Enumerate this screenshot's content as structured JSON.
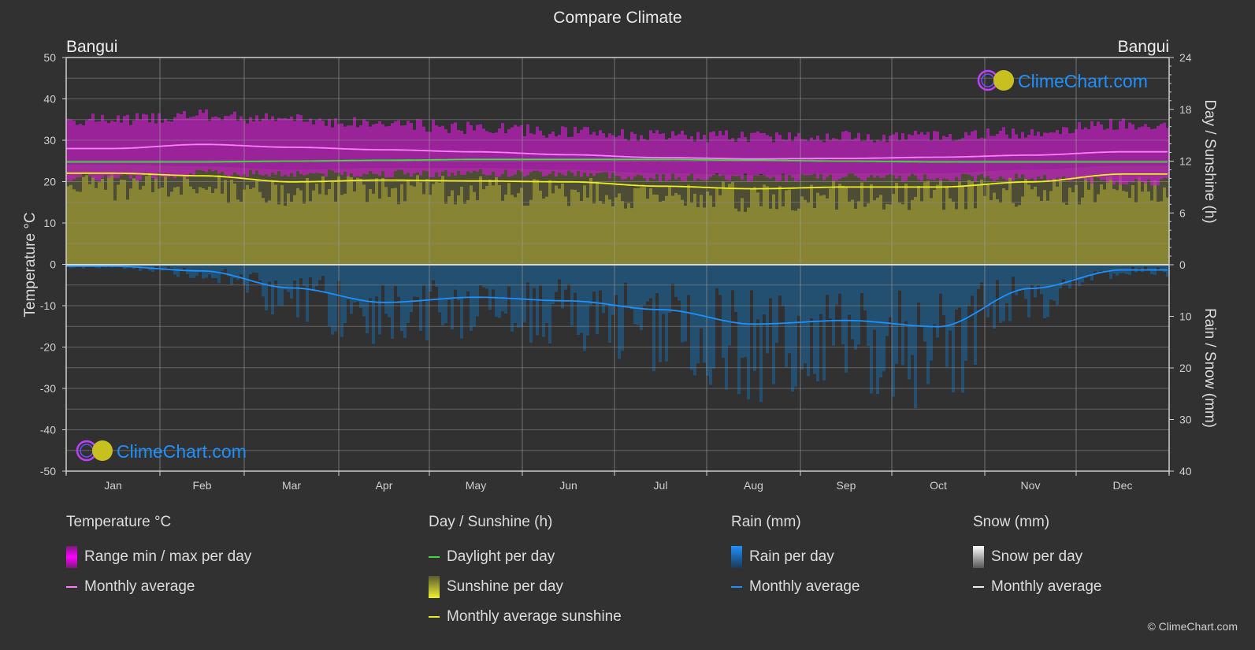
{
  "title": "Compare Climate",
  "location_left": "Bangui",
  "location_right": "Bangui",
  "watermark": "ClimeChart.com",
  "copyright": "© ClimeChart.com",
  "colors": {
    "background": "#313131",
    "temp_range": "#c81ec8",
    "temp_avg": "#ff7cff",
    "daylight": "#3ddc3d",
    "sunshine_fill": "#8c8a35",
    "sunshine_avg": "#f0f020",
    "rain_fill": "#1f5a85",
    "rain_avg": "#1e90ff",
    "brand": "#1e90ff"
  },
  "legend": {
    "temperature": {
      "title": "Temperature °C",
      "items": [
        "Range min / max per day",
        "Monthly average"
      ]
    },
    "sunshine": {
      "title": "Day / Sunshine (h)",
      "items": [
        "Daylight per day",
        "Sunshine per day",
        "Monthly average sunshine"
      ]
    },
    "rain": {
      "title": "Rain (mm)",
      "items": [
        "Rain per day",
        "Monthly average"
      ]
    },
    "snow": {
      "title": "Snow (mm)",
      "items": [
        "Snow per day",
        "Monthly average"
      ]
    }
  },
  "chart_data": {
    "type": "area",
    "title": "Compare Climate",
    "categories": [
      "Jan",
      "Feb",
      "Mar",
      "Apr",
      "May",
      "Jun",
      "Jul",
      "Aug",
      "Sep",
      "Oct",
      "Nov",
      "Dec"
    ],
    "y_left": {
      "label": "Temperature °C",
      "range": [
        -50,
        50
      ],
      "ticks": [
        "50",
        "40",
        "30",
        "20",
        "10",
        "0",
        "-10",
        "-20",
        "-30",
        "-40",
        "-50"
      ]
    },
    "y_right_top": {
      "label": "Day / Sunshine (h)",
      "range": [
        0,
        24
      ],
      "ticks": [
        "24",
        "18",
        "12",
        "6",
        "0"
      ]
    },
    "y_right_bottom": {
      "label": "Rain / Snow (mm)",
      "range": [
        0,
        40
      ],
      "ticks": [
        "0",
        "10",
        "20",
        "30",
        "40"
      ]
    },
    "grid": true,
    "series": [
      {
        "name": "Temperature max (approx daily band top)",
        "axis": "temp",
        "values": [
          35,
          36,
          35,
          34,
          33,
          32,
          31,
          31,
          31,
          31,
          32,
          34
        ]
      },
      {
        "name": "Temperature min (approx daily band bottom)",
        "axis": "temp",
        "values": [
          21,
          22,
          22,
          22,
          22,
          22,
          21,
          21,
          21,
          21,
          21,
          20
        ]
      },
      {
        "name": "Temperature monthly average",
        "axis": "temp",
        "values": [
          28.0,
          29.0,
          28.3,
          27.7,
          27.2,
          26.5,
          25.8,
          25.5,
          25.6,
          25.9,
          26.4,
          27.2
        ]
      },
      {
        "name": "Daylight per day",
        "axis": "sun",
        "values": [
          11.9,
          11.9,
          12.0,
          12.1,
          12.2,
          12.2,
          12.2,
          12.1,
          12.0,
          11.9,
          11.9,
          11.9
        ]
      },
      {
        "name": "Sunshine per day (approx)",
        "axis": "sun",
        "values": [
          10.8,
          10.6,
          10.2,
          10.4,
          10.4,
          10.2,
          9.8,
          9.6,
          9.8,
          9.8,
          10.2,
          10.7
        ]
      },
      {
        "name": "Monthly average sunshine",
        "axis": "sun",
        "values": [
          10.6,
          10.3,
          9.6,
          9.8,
          9.7,
          9.6,
          9.1,
          8.8,
          9.0,
          9.0,
          9.6,
          10.5
        ]
      },
      {
        "name": "Rain monthly average",
        "axis": "rain",
        "values": [
          0.3,
          1.2,
          4.5,
          7.3,
          6.3,
          7.0,
          8.7,
          11.5,
          10.8,
          12.0,
          4.6,
          1.0
        ]
      },
      {
        "name": "Snow monthly average",
        "axis": "rain",
        "values": [
          0,
          0,
          0,
          0,
          0,
          0,
          0,
          0,
          0,
          0,
          0,
          0
        ]
      }
    ]
  }
}
